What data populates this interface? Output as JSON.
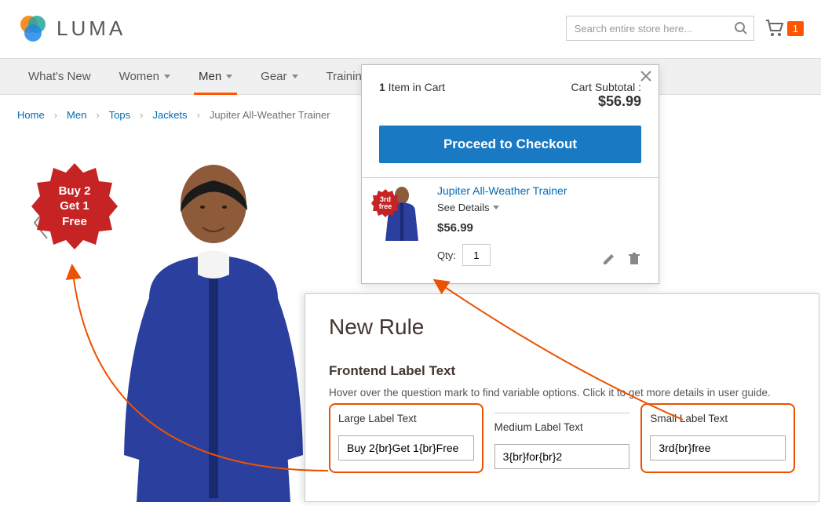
{
  "header": {
    "logo_text": "LUMA",
    "search_placeholder": "Search entire store here...",
    "cart_count": "1"
  },
  "nav": {
    "items": [
      "What's New",
      "Women",
      "Men",
      "Gear",
      "Training"
    ],
    "active_index": 2
  },
  "breadcrumb": {
    "items": [
      "Home",
      "Men",
      "Tops",
      "Jackets"
    ],
    "current": "Jupiter All-Weather Trainer"
  },
  "product": {
    "badge_large": {
      "line1": "Buy 2",
      "line2": "Get 1",
      "line3": "Free"
    }
  },
  "minicart": {
    "items_count": "1",
    "items_label": " Item in Cart",
    "subtotal_label": "Cart Subtotal :",
    "subtotal_value": "$56.99",
    "checkout_label": "Proceed to Checkout",
    "item": {
      "name": "Jupiter All-Weather Trainer",
      "see_details": "See Details",
      "price": "$56.99",
      "qty_label": "Qty:",
      "qty_value": "1",
      "badge": {
        "line1": "3rd",
        "line2": "free"
      }
    }
  },
  "admin": {
    "title": "New Rule",
    "section": "Frontend Label Text",
    "hint": "Hover over the question mark to find variable options. Click it to get more details in user guide.",
    "fields": {
      "large": {
        "label": "Large Label Text",
        "value": "Buy 2{br}Get 1{br}Free"
      },
      "medium": {
        "label": "Medium Label Text",
        "value": "3{br}for{br}2"
      },
      "small": {
        "label": "Small Label Text",
        "value": "3rd{br}free"
      }
    }
  },
  "colors": {
    "accent": "#ff5501",
    "link": "#006bb4",
    "primary_btn": "#1979c3",
    "badge": "#c62424",
    "admin_accent": "#eb5202"
  }
}
